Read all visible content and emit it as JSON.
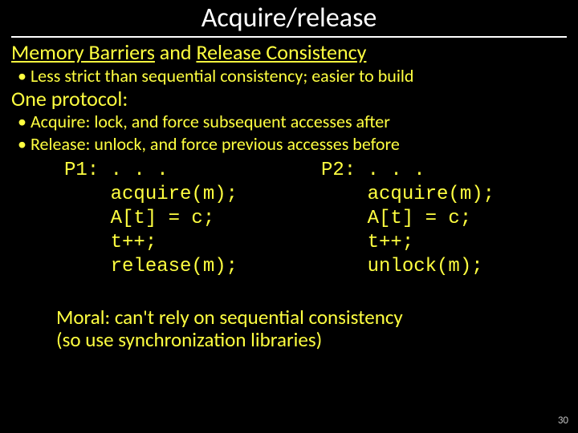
{
  "title": "Acquire/release",
  "subtitle": {
    "a": "Memory Barriers",
    "b": " and ",
    "c": "Release Consistency"
  },
  "bullet1": "Less strict than sequential consistency; easier to build",
  "proto_heading": "One protocol:",
  "bullet2": "Acquire: lock, and force subsequent accesses after",
  "bullet3": "Release: unlock, and force previous accesses before",
  "code": {
    "p1_label": "P1: . . .",
    "p1_lines": "    acquire(m);\n    A[t] = c;\n    t++;\n    release(m);",
    "p2_label": "P2: . . .",
    "p2_lines": "    acquire(m);\n    A[t] = c;\n    t++;\n    unlock(m);"
  },
  "moral_l1": "Moral: can't rely on sequential consistency",
  "moral_l2": "(so use synchronization libraries)",
  "page": "30"
}
